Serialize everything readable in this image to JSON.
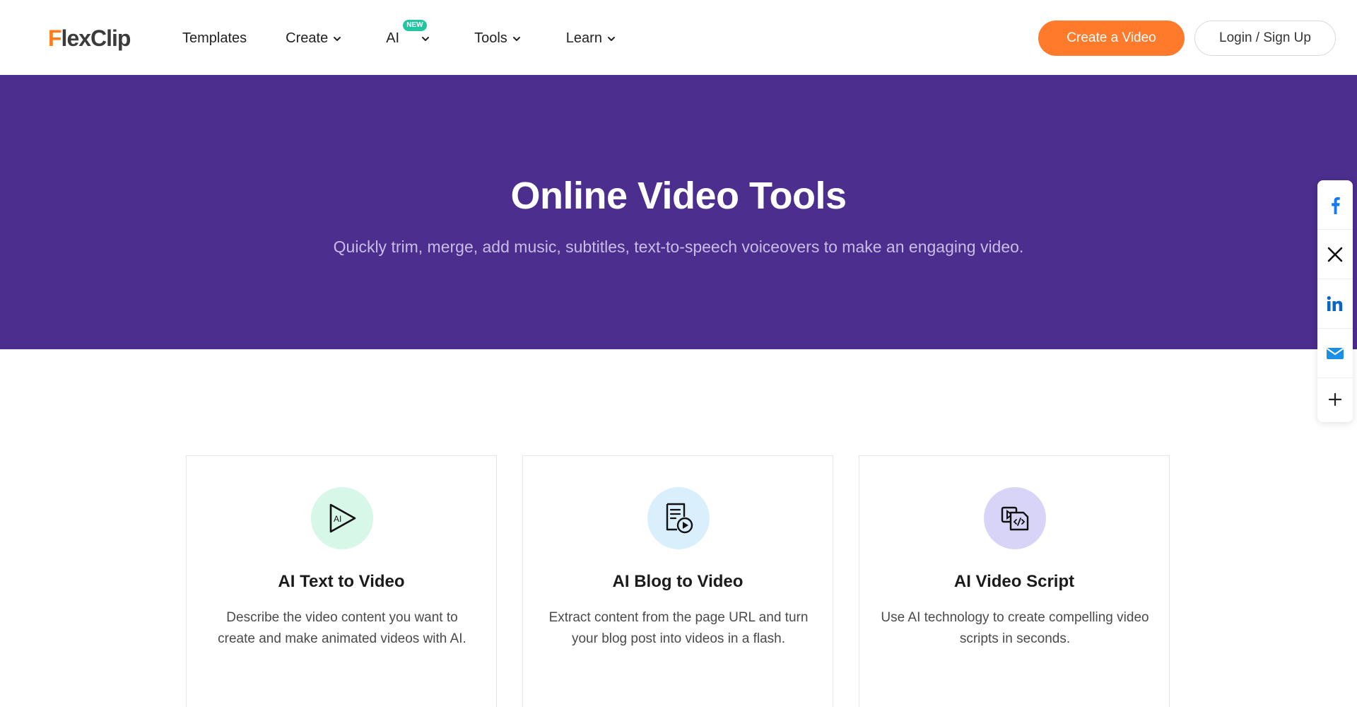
{
  "header": {
    "logo": {
      "part_a": "F",
      "part_b": "lexClip"
    },
    "nav": {
      "templates": "Templates",
      "create": "Create",
      "ai": "AI",
      "ai_badge": "NEW",
      "tools": "Tools",
      "learn": "Learn"
    },
    "create_video_label": "Create a Video",
    "login_label": "Login / Sign Up",
    "accent_color": "#ff7a2b"
  },
  "hero": {
    "title": "Online Video Tools",
    "subtitle": "Quickly trim, merge, add music, subtitles, text-to-speech voiceovers to make an engaging video.",
    "background_color": "#4b2e8d"
  },
  "share": {
    "items": [
      "facebook-icon",
      "x-icon",
      "linkedin-icon",
      "email-icon",
      "plus-icon"
    ]
  },
  "cards": [
    {
      "title": "AI Text to Video",
      "desc": "Describe the video content you want to create and make animated videos with AI.",
      "icon": "ai-play-icon",
      "icon_bg": "#d7f7e8"
    },
    {
      "title": "AI Blog to Video",
      "desc": "Extract content from the page URL and turn your blog post into videos in a flash.",
      "icon": "blog-video-icon",
      "icon_bg": "#d9effc"
    },
    {
      "title": "AI Video Script",
      "desc": "Use AI technology to create compelling video scripts in seconds.",
      "icon": "video-script-icon",
      "icon_bg": "#d8d4f7"
    }
  ]
}
